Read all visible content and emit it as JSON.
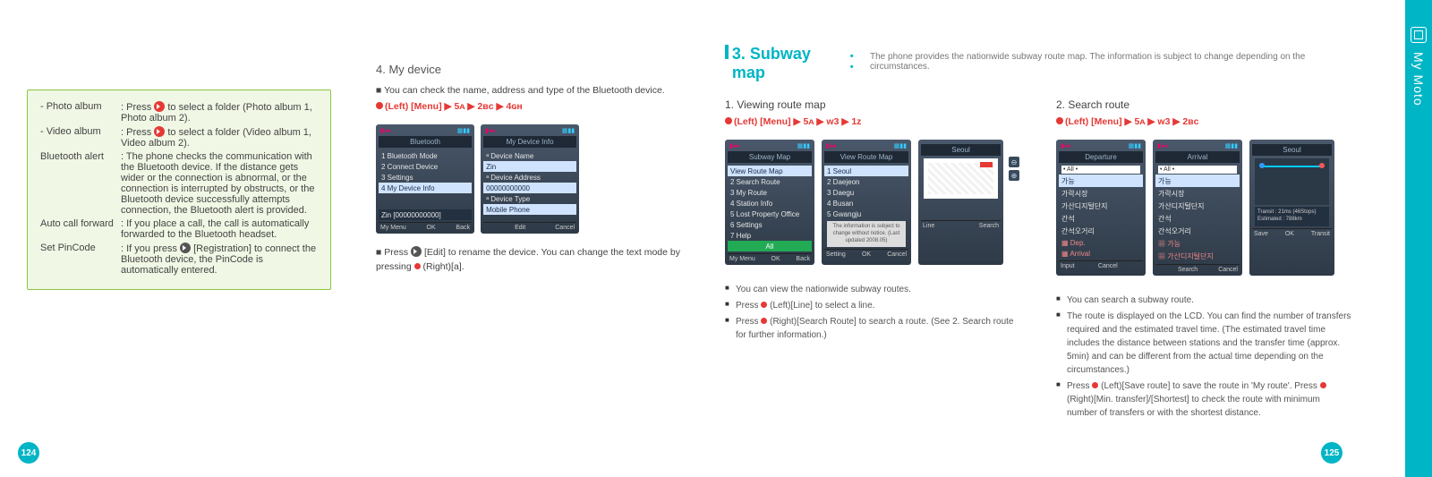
{
  "tab": {
    "label": "My Moto"
  },
  "pageNumbers": {
    "left": "124",
    "right": "125"
  },
  "leftBox": {
    "rows": [
      {
        "label": "- Photo album",
        "desc_pre": ": Press ",
        "desc_post": " to select a folder (Photo album 1, Photo album 2)."
      },
      {
        "label": "- Video album",
        "desc_pre": ": Press ",
        "desc_post": " to select a folder (Video album 1, Video album 2)."
      },
      {
        "label": "Bluetooth alert",
        "desc": ": The phone checks the communication with the Bluetooth device. If the distance gets wider or the connection is abnormal, or the connection is interrupted by obstructs, or the Bluetooth device successfully attempts connection, the Bluetooth alert is provided."
      },
      {
        "label": "Auto call forward",
        "desc": ": If you place a call, the call is automatically forwarded to the Bluetooth headset."
      },
      {
        "label": "Set PinCode",
        "desc_pre": ": If you press ",
        "desc_mid": " [Registration] to connect the Bluetooth device, the PinCode is automatically entered.",
        "desc_post": ""
      }
    ]
  },
  "leftCol2": {
    "title": "4. My device",
    "line1": "■ You can check the name, address and type of the Bluetooth device.",
    "navpath": "(Left) [Menu]  ▶  5ᴀ  ▶  2ʙᴄ  ▶  4ɢʜ",
    "phone1": {
      "title": "Bluetooth",
      "items": [
        "1 Bluetooth Mode",
        "2 Connect Device",
        "3 Settings",
        "4 My Device Info"
      ],
      "footL": "My Menu",
      "footC": "OK",
      "footR": "Back",
      "zin": "Zin [00000000000]"
    },
    "phone2": {
      "title": "My Device Info",
      "items": [
        "ᵃ Device Name",
        "  Zin",
        "ᵃ Device Address",
        "  00000000000",
        "ᵃ Device Type",
        "  Mobile Phone"
      ],
      "footL": "",
      "footC": "Edit",
      "footR": "Cancel"
    },
    "line2_pre": "■ Press ",
    "line2_mid": " [Edit] to rename the device. You can change the text mode by pressing ",
    "line2_post": " (Right)[a]."
  },
  "rightPage": {
    "headerNum": "3.",
    "headerTitle": "Subway map",
    "headerDots": "• •",
    "headerDesc": "The phone provides the nationwide subway route map. The information is subject to change depending on the circumstances.",
    "col1": {
      "title": "1. Viewing route map",
      "navpath": "(Left) [Menu]  ▶  5ᴀ  ▶  ᴡ3  ▶  1ᴢ",
      "phoneA": {
        "title": "Subway Map",
        "items": [
          "View Route Map",
          "2 Search Route",
          "3 My Route",
          "4 Station Info",
          "5 Lost Property Office",
          "6 Settings",
          "7 Help"
        ],
        "bar": "All",
        "footL": "My Menu",
        "footC": "OK",
        "footR": "Back"
      },
      "phoneB": {
        "title": "View Route Map",
        "items": [
          "1 Seoul",
          "2 Daejeon",
          "3 Daegu",
          "4 Busan",
          "5 Gwangju"
        ],
        "info": "The information is subject to change without notice. (Last updated 2008.05)",
        "footL": "Setting",
        "footC": "OK",
        "footR": "Cancel"
      },
      "phoneC": {
        "title": "Seoul",
        "footL": "Line",
        "footR": "Search"
      },
      "bullets": [
        "You can view the nationwide subway routes.",
        "Press <dot> (Left)[Line] to select a line.",
        "Press <dot> (Right)[Search Route] to search a route. (See 2. Search route for further information.)"
      ]
    },
    "col2": {
      "title": "2. Search route",
      "navpath": "(Left) [Menu]  ▶  5ᴀ  ▶  ᴡ3  ▶  2ʙᴄ",
      "phoneA": {
        "title": "Departure",
        "minput": "• All •",
        "items": [
          "가능",
          "가락시장",
          "가산디지털단지",
          "간석",
          "간석오거리"
        ],
        "tags": [
          "Dep.",
          "Arrival"
        ],
        "footL": "Input",
        "footC": "Cancel",
        "footR": ""
      },
      "phoneB": {
        "title": "Arrival",
        "minput": "• All •",
        "items": [
          "가능",
          "가락시장",
          "가산디지털단지",
          "간석",
          "간석오거리"
        ],
        "tags": [
          "가능",
          "가산디지털단지"
        ],
        "footL": "",
        "footC": "Search",
        "footR": "Cancel"
      },
      "phoneC": {
        "title": "Seoul",
        "result": "Transit : 21ms (46Stops)\nEstimated : 788km",
        "footL": "Save",
        "footC": "OK",
        "footR": "Transit"
      },
      "bullets": [
        "You can search a subway route.",
        "The route is displayed on the LCD. You can find the number of transfers required and the estimated travel time. (The estimated travel time includes the distance between stations and the transfer time (approx. 5min) and can be different from the actual time depending on the circumstances.)",
        "Press <dot> (Left)[Save route] to save the route in 'My route'. Press <dot> (Right)[Min. transfer]/[Shortest] to check the route with minimum number of transfers or with the shortest distance."
      ]
    }
  }
}
